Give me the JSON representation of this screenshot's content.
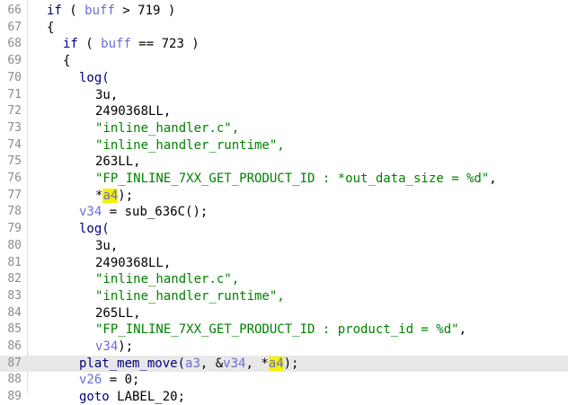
{
  "editor": {
    "lines": [
      {
        "no": "66",
        "tokens": [
          [
            "if",
            "kw"
          ],
          [
            " ( ",
            ""
          ],
          [
            "buff",
            "var"
          ],
          [
            " > 719 )",
            ""
          ]
        ]
      },
      {
        "no": "67",
        "tokens": [
          [
            "{",
            ""
          ]
        ]
      },
      {
        "no": "68",
        "tokens": [
          [
            "if",
            "kw"
          ],
          [
            " ( ",
            ""
          ],
          [
            "buff",
            "var"
          ],
          [
            " == 723 )",
            ""
          ]
        ]
      },
      {
        "no": "69",
        "tokens": [
          [
            "{",
            ""
          ]
        ]
      },
      {
        "no": "70",
        "tokens": [
          [
            "log(",
            "fn"
          ]
        ]
      },
      {
        "no": "71",
        "tokens": [
          [
            "3u,",
            ""
          ]
        ]
      },
      {
        "no": "72",
        "tokens": [
          [
            "2490368LL,",
            ""
          ]
        ]
      },
      {
        "no": "73",
        "tokens": [
          [
            "\"inline_handler.c\",",
            "str"
          ]
        ]
      },
      {
        "no": "74",
        "tokens": [
          [
            "\"inline_handler_runtime\",",
            "str"
          ]
        ]
      },
      {
        "no": "75",
        "tokens": [
          [
            "263LL,",
            ""
          ]
        ]
      },
      {
        "no": "76",
        "tokens": [
          [
            "\"FP_INLINE_7XX_GET_PRODUCT_ID : *out_data_size = %d\"",
            "str"
          ],
          [
            ",",
            ""
          ]
        ]
      },
      {
        "no": "77",
        "tokens": [
          [
            "*",
            ""
          ],
          [
            "a4",
            "hl"
          ],
          [
            ");",
            ""
          ]
        ]
      },
      {
        "no": "78",
        "tokens": [
          [
            "v34",
            "var"
          ],
          [
            " = sub_636C();",
            ""
          ]
        ]
      },
      {
        "no": "79",
        "tokens": [
          [
            "log(",
            "fn"
          ]
        ]
      },
      {
        "no": "80",
        "tokens": [
          [
            "3u,",
            ""
          ]
        ]
      },
      {
        "no": "81",
        "tokens": [
          [
            "2490368LL,",
            ""
          ]
        ]
      },
      {
        "no": "82",
        "tokens": [
          [
            "\"inline_handler.c\",",
            "str"
          ]
        ]
      },
      {
        "no": "83",
        "tokens": [
          [
            "\"inline_handler_runtime\",",
            "str"
          ]
        ]
      },
      {
        "no": "84",
        "tokens": [
          [
            "265LL,",
            ""
          ]
        ]
      },
      {
        "no": "85",
        "tokens": [
          [
            "\"FP_INLINE_7XX_GET_PRODUCT_ID : product_id = %d\"",
            "str"
          ],
          [
            ",",
            ""
          ]
        ]
      },
      {
        "no": "86",
        "tokens": [
          [
            "v34",
            "var"
          ],
          [
            ");",
            ""
          ]
        ]
      },
      {
        "no": "87",
        "tokens": [
          [
            "plat_mem_move(",
            "fn"
          ],
          [
            "a3",
            "var"
          ],
          [
            ", &",
            ""
          ],
          [
            "v34",
            "var"
          ],
          [
            ", *",
            ""
          ],
          [
            "a4",
            "hl"
          ],
          [
            ");",
            ""
          ]
        ]
      },
      {
        "no": "88",
        "tokens": [
          [
            "v26",
            "var"
          ],
          [
            " = 0;",
            ""
          ]
        ]
      },
      {
        "no": "89",
        "tokens": [
          [
            "goto",
            "kw"
          ],
          [
            " LABEL_20;",
            ""
          ]
        ]
      }
    ],
    "current_line": "87",
    "colors": {
      "keyword": "#000080",
      "variable": "#6b6bd8",
      "string": "#008000",
      "highlight": "#f2f200",
      "current_line_bg": "#e8e8e8",
      "line_number": "#8c8c8c"
    }
  }
}
